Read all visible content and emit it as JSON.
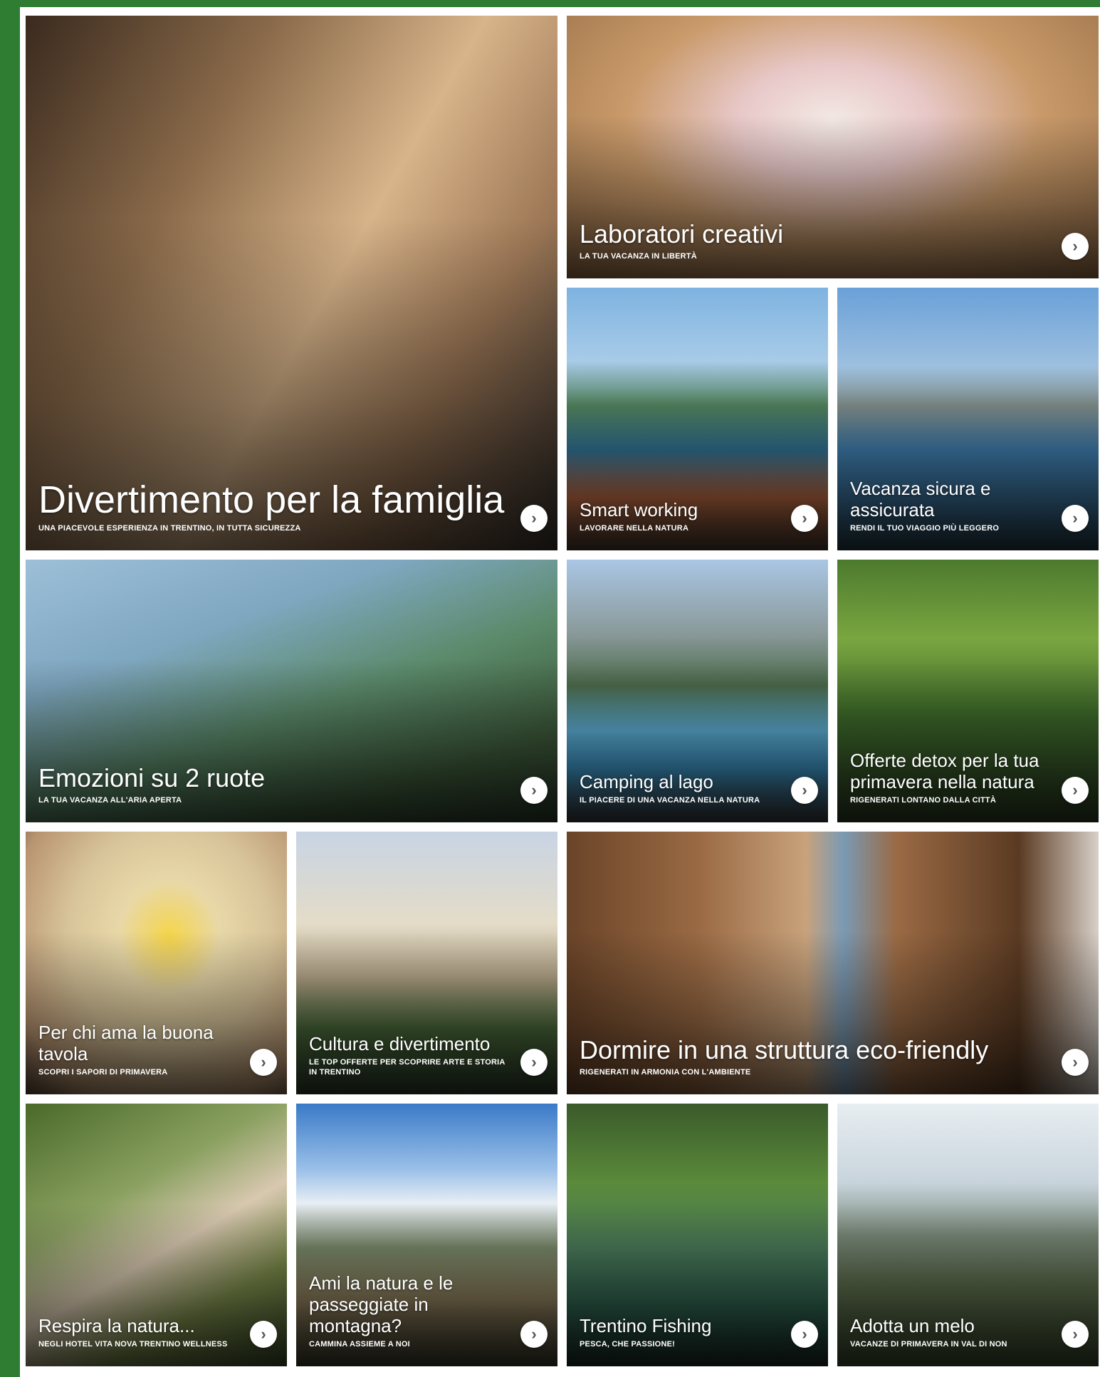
{
  "tiles": [
    {
      "title": "Divertimento per la famiglia",
      "subtitle": "UNA PIACEVOLE ESPERIENZA IN TRENTINO, IN TUTTA SICUREZZA"
    },
    {
      "title": "Laboratori creativi",
      "subtitle": "LA TUA VACANZA IN LIBERTÀ"
    },
    {
      "title": "Smart working",
      "subtitle": "LAVORARE NELLA NATURA"
    },
    {
      "title": "Vacanza sicura e assicurata",
      "subtitle": "RENDI IL TUO VIAGGIO PIÙ LEGGERO"
    },
    {
      "title": "Emozioni su 2 ruote",
      "subtitle": "LA TUA VACANZA ALL'ARIA APERTA"
    },
    {
      "title": "Camping al lago",
      "subtitle": "IL PIACERE DI UNA VACANZA NELLA NATURA"
    },
    {
      "title": "Offerte detox per la tua primavera nella natura",
      "subtitle": "RIGENERATI LONTANO DALLA CITTÀ"
    },
    {
      "title": "Per chi ama la buona tavola",
      "subtitle": "SCOPRI I SAPORI DI PRIMAVERA"
    },
    {
      "title": "Cultura e divertimento",
      "subtitle": "LE TOP OFFERTE PER SCOPRIRE ARTE E STORIA IN TRENTINO"
    },
    {
      "title": "Dormire in una struttura eco-friendly",
      "subtitle": "RIGENERATI IN ARMONIA CON L'AMBIENTE"
    },
    {
      "title": "Respira la natura...",
      "subtitle": "NEGLI HOTEL VITA NOVA TRENTINO WELLNESS"
    },
    {
      "title": "Ami la natura e le passeggiate in montagna?",
      "subtitle": "CAMMINA ASSIEME A NOI"
    },
    {
      "title": "Trentino Fishing",
      "subtitle": "PESCA, CHE PASSIONE!"
    },
    {
      "title": "Adotta un melo",
      "subtitle": "VACANZE DI PRIMAVERA IN VAL DI NON"
    }
  ],
  "arrow_glyph": "›",
  "colors": {
    "frame": "#2e7d32",
    "text": "#ffffff",
    "button": "#ffffff"
  }
}
